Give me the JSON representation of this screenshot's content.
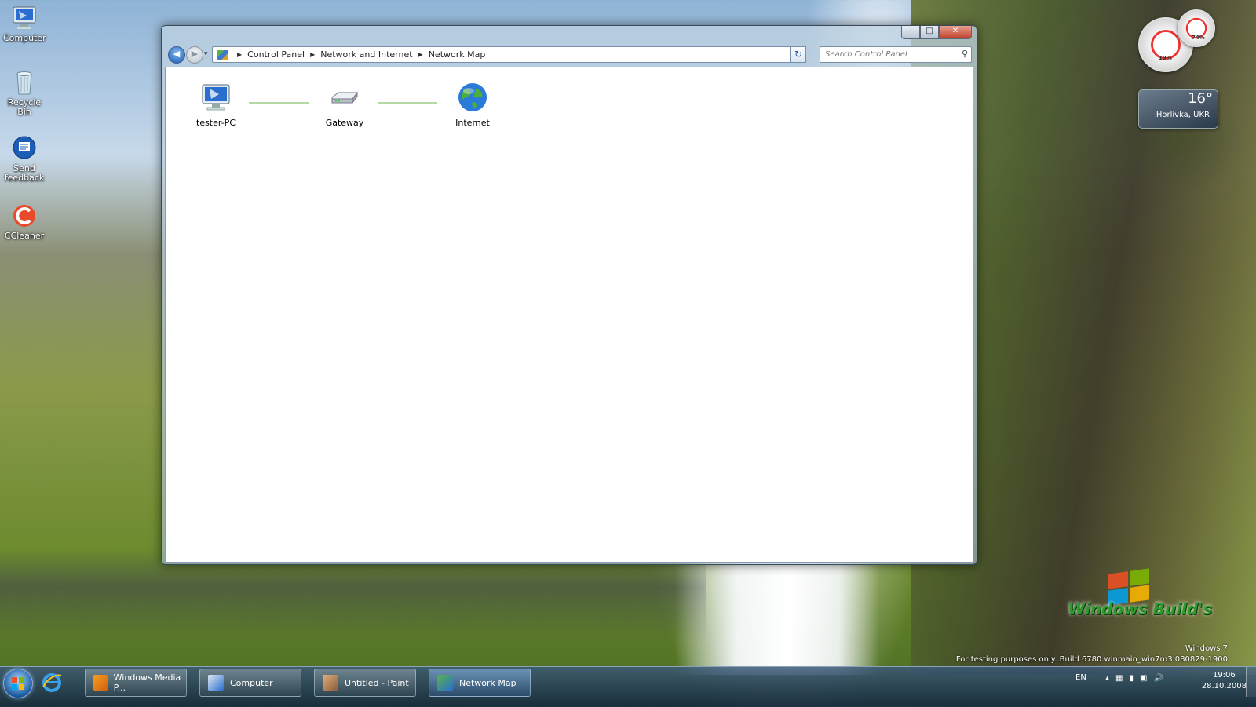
{
  "desktop": {
    "icons": [
      {
        "label": "Computer",
        "icon": "computer-icon"
      },
      {
        "label": "Recycle Bin",
        "icon": "recycle-bin-icon"
      },
      {
        "label": "Send feedback",
        "icon": "feedback-icon"
      },
      {
        "label": "CCleaner",
        "icon": "ccleaner-icon"
      }
    ]
  },
  "window": {
    "caption_buttons": {
      "minimize": "–",
      "maximize": "□",
      "close": "✕"
    },
    "nav": {
      "back": "◀",
      "forward": "▶",
      "recent": "▾"
    },
    "breadcrumb": [
      "Control Panel",
      "Network and Internet",
      "Network Map"
    ],
    "breadcrumb_separator": "▶",
    "address_dropdown": "▾",
    "refresh": "↻",
    "search": {
      "placeholder": "Search Control Panel",
      "value": ""
    },
    "map": {
      "nodes": [
        {
          "label": "tester-PC",
          "icon": "computer-icon"
        },
        {
          "label": "Gateway",
          "icon": "router-icon"
        },
        {
          "label": "Internet",
          "icon": "globe-icon"
        }
      ]
    }
  },
  "gadgets": {
    "cpu_percent": "19%",
    "memory_percent": "74%",
    "weather": {
      "temperature": "16°",
      "location": "Horlivka, UKR"
    }
  },
  "watermark": {
    "brand": "Windows Build's",
    "os": "Windows 7",
    "build": "For testing purposes only. Build 6780.winmain_win7m3.080829-1900"
  },
  "taskbar": {
    "tasks": [
      {
        "label": "Windows Media P...",
        "icon": "media-player-icon",
        "active": false
      },
      {
        "label": "Computer",
        "icon": "computer-icon",
        "active": false
      },
      {
        "label": "Untitled - Paint",
        "icon": "paint-icon",
        "active": false
      },
      {
        "label": "Network Map",
        "icon": "network-map-icon",
        "active": true
      }
    ],
    "tray": {
      "language": "EN",
      "icons": [
        "▴",
        "▦",
        "▮",
        "▣",
        "🔊"
      ],
      "time": "19:06",
      "date": "28.10.2008"
    }
  },
  "colors": {
    "accent": "#1d5db5",
    "link_line": "#b5d8a4",
    "brand_green": "#2e9a2e"
  }
}
